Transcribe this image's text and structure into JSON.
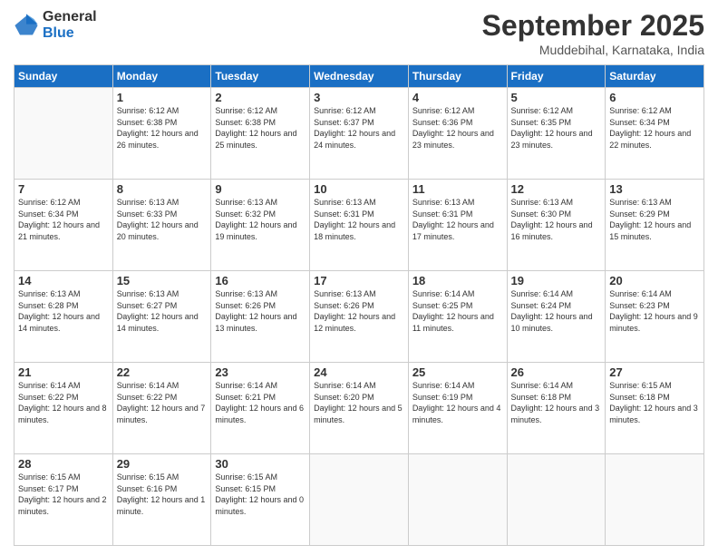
{
  "logo": {
    "general": "General",
    "blue": "Blue"
  },
  "header": {
    "month": "September 2025",
    "location": "Muddebihal, Karnataka, India"
  },
  "weekdays": [
    "Sunday",
    "Monday",
    "Tuesday",
    "Wednesday",
    "Thursday",
    "Friday",
    "Saturday"
  ],
  "weeks": [
    [
      {
        "day": "",
        "empty": true
      },
      {
        "day": "1",
        "sunrise": "6:12 AM",
        "sunset": "6:38 PM",
        "daylight": "12 hours and 26 minutes."
      },
      {
        "day": "2",
        "sunrise": "6:12 AM",
        "sunset": "6:38 PM",
        "daylight": "12 hours and 25 minutes."
      },
      {
        "day": "3",
        "sunrise": "6:12 AM",
        "sunset": "6:37 PM",
        "daylight": "12 hours and 24 minutes."
      },
      {
        "day": "4",
        "sunrise": "6:12 AM",
        "sunset": "6:36 PM",
        "daylight": "12 hours and 23 minutes."
      },
      {
        "day": "5",
        "sunrise": "6:12 AM",
        "sunset": "6:35 PM",
        "daylight": "12 hours and 23 minutes."
      },
      {
        "day": "6",
        "sunrise": "6:12 AM",
        "sunset": "6:34 PM",
        "daylight": "12 hours and 22 minutes."
      }
    ],
    [
      {
        "day": "7",
        "sunrise": "6:12 AM",
        "sunset": "6:34 PM",
        "daylight": "12 hours and 21 minutes."
      },
      {
        "day": "8",
        "sunrise": "6:13 AM",
        "sunset": "6:33 PM",
        "daylight": "12 hours and 20 minutes."
      },
      {
        "day": "9",
        "sunrise": "6:13 AM",
        "sunset": "6:32 PM",
        "daylight": "12 hours and 19 minutes."
      },
      {
        "day": "10",
        "sunrise": "6:13 AM",
        "sunset": "6:31 PM",
        "daylight": "12 hours and 18 minutes."
      },
      {
        "day": "11",
        "sunrise": "6:13 AM",
        "sunset": "6:31 PM",
        "daylight": "12 hours and 17 minutes."
      },
      {
        "day": "12",
        "sunrise": "6:13 AM",
        "sunset": "6:30 PM",
        "daylight": "12 hours and 16 minutes."
      },
      {
        "day": "13",
        "sunrise": "6:13 AM",
        "sunset": "6:29 PM",
        "daylight": "12 hours and 15 minutes."
      }
    ],
    [
      {
        "day": "14",
        "sunrise": "6:13 AM",
        "sunset": "6:28 PM",
        "daylight": "12 hours and 14 minutes."
      },
      {
        "day": "15",
        "sunrise": "6:13 AM",
        "sunset": "6:27 PM",
        "daylight": "12 hours and 14 minutes."
      },
      {
        "day": "16",
        "sunrise": "6:13 AM",
        "sunset": "6:26 PM",
        "daylight": "12 hours and 13 minutes."
      },
      {
        "day": "17",
        "sunrise": "6:13 AM",
        "sunset": "6:26 PM",
        "daylight": "12 hours and 12 minutes."
      },
      {
        "day": "18",
        "sunrise": "6:14 AM",
        "sunset": "6:25 PM",
        "daylight": "12 hours and 11 minutes."
      },
      {
        "day": "19",
        "sunrise": "6:14 AM",
        "sunset": "6:24 PM",
        "daylight": "12 hours and 10 minutes."
      },
      {
        "day": "20",
        "sunrise": "6:14 AM",
        "sunset": "6:23 PM",
        "daylight": "12 hours and 9 minutes."
      }
    ],
    [
      {
        "day": "21",
        "sunrise": "6:14 AM",
        "sunset": "6:22 PM",
        "daylight": "12 hours and 8 minutes."
      },
      {
        "day": "22",
        "sunrise": "6:14 AM",
        "sunset": "6:22 PM",
        "daylight": "12 hours and 7 minutes."
      },
      {
        "day": "23",
        "sunrise": "6:14 AM",
        "sunset": "6:21 PM",
        "daylight": "12 hours and 6 minutes."
      },
      {
        "day": "24",
        "sunrise": "6:14 AM",
        "sunset": "6:20 PM",
        "daylight": "12 hours and 5 minutes."
      },
      {
        "day": "25",
        "sunrise": "6:14 AM",
        "sunset": "6:19 PM",
        "daylight": "12 hours and 4 minutes."
      },
      {
        "day": "26",
        "sunrise": "6:14 AM",
        "sunset": "6:18 PM",
        "daylight": "12 hours and 3 minutes."
      },
      {
        "day": "27",
        "sunrise": "6:15 AM",
        "sunset": "6:18 PM",
        "daylight": "12 hours and 3 minutes."
      }
    ],
    [
      {
        "day": "28",
        "sunrise": "6:15 AM",
        "sunset": "6:17 PM",
        "daylight": "12 hours and 2 minutes."
      },
      {
        "day": "29",
        "sunrise": "6:15 AM",
        "sunset": "6:16 PM",
        "daylight": "12 hours and 1 minute."
      },
      {
        "day": "30",
        "sunrise": "6:15 AM",
        "sunset": "6:15 PM",
        "daylight": "12 hours and 0 minutes."
      },
      {
        "day": "",
        "empty": true
      },
      {
        "day": "",
        "empty": true
      },
      {
        "day": "",
        "empty": true
      },
      {
        "day": "",
        "empty": true
      }
    ]
  ]
}
